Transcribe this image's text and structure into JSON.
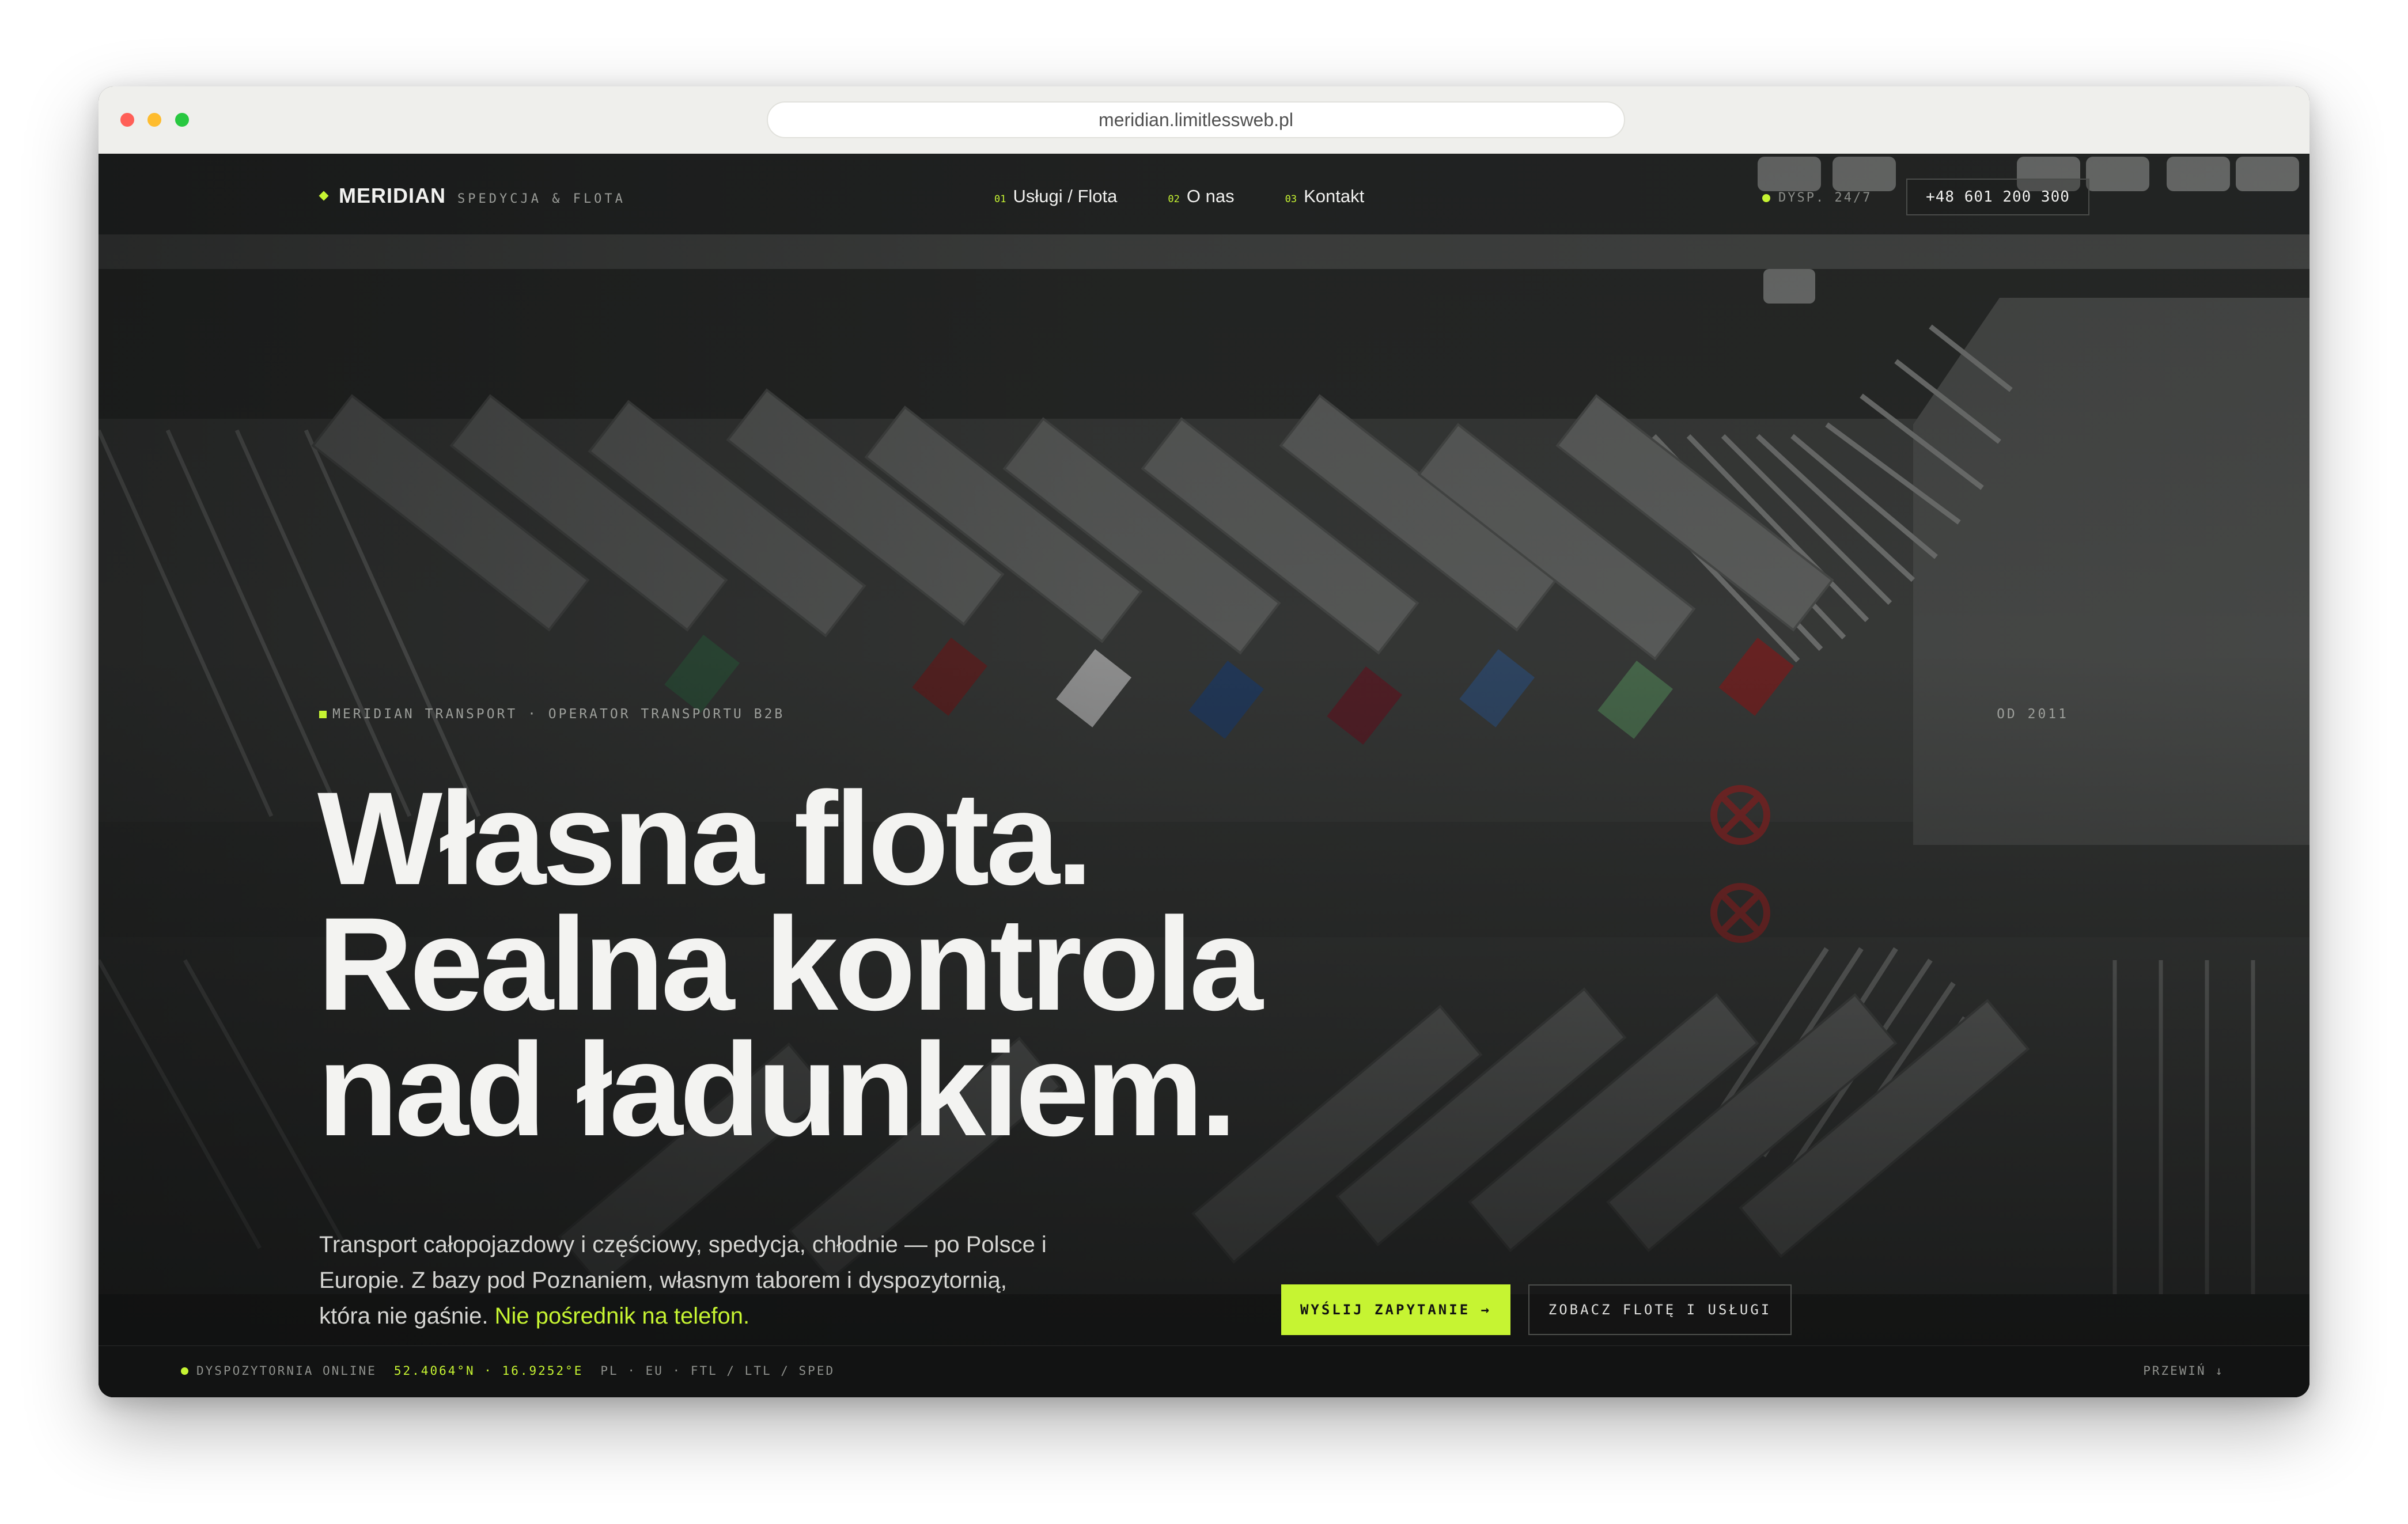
{
  "browser": {
    "url": "meridian.limitlessweb.pl"
  },
  "nav": {
    "brand_name": "MERIDIAN",
    "brand_sub": "SPEDYCJA & FLOTA",
    "items": [
      {
        "num": "01",
        "label": "Usługi / Flota"
      },
      {
        "num": "02",
        "label": "O nas"
      },
      {
        "num": "03",
        "label": "Kontakt"
      }
    ],
    "status": "DYSP. 24/7",
    "phone": "+48 601 200 300"
  },
  "hero": {
    "eyebrow": "MERIDIAN TRANSPORT · OPERATOR TRANSPORTU B2B",
    "since": "OD 2011",
    "headline": [
      "Własna flota.",
      "Realna kontrola",
      "nad ładunkiem."
    ],
    "lead": "Transport całopojazdowy i częściowy, spedycja, chłodnie — po Polsce i Europie. Z bazy pod Poznaniem, własnym taborem i dyspozytornią, która nie gaśnie. ",
    "lead_accent": "Nie pośrednik na telefon.",
    "cta_primary": "WYŚLIJ ZAPYTANIE →",
    "cta_secondary": "ZOBACZ FLOTĘ I USŁUGI"
  },
  "strip": {
    "status": "DYSPOZYTORNIA ONLINE",
    "coords": "52.4064°N · 16.9252°E",
    "tags": "PL · EU · FTL / LTL / SPED",
    "scroll": "PRZEWIŃ ↓"
  },
  "colors": {
    "accent": "#c6f432",
    "background": "#161717",
    "text": "#f3f3f1"
  }
}
